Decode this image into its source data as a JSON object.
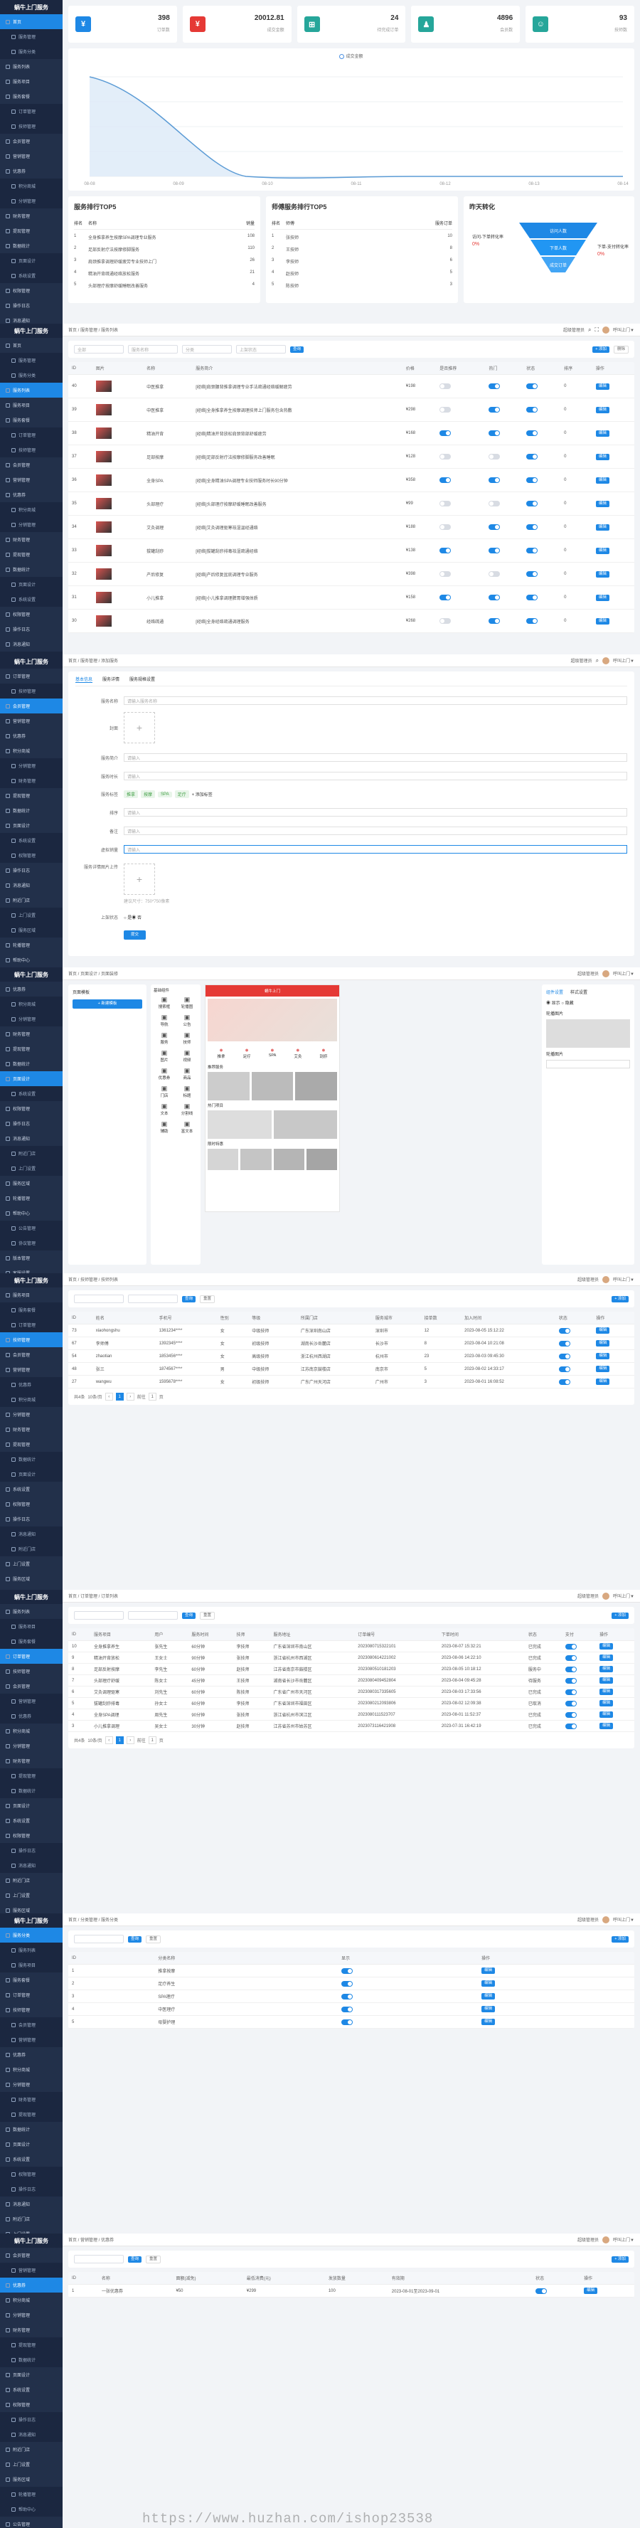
{
  "app": {
    "logo": "蜗牛上门服务",
    "user": "超级管理员",
    "user_short": "呼叫上门▼"
  },
  "common": {
    "add_btn": "+ 添加",
    "search_btn": "查询",
    "reset_btn": "重置",
    "edit_btn": "编辑",
    "del_btn": "删除",
    "total": "共4条",
    "per_page": "10条/页",
    "goto": "前往",
    "page_unit": "页"
  },
  "sidebar_main": [
    "首页",
    "服务管理",
    "服务分类",
    "服务列表",
    "服务项目",
    "服务套餐",
    "订单管理",
    "技师管理",
    "会员管理",
    "营销管理",
    "优惠券",
    "积分商城",
    "分销管理",
    "财务管理",
    "提现管理",
    "数据统计",
    "页面设计",
    "系统设置",
    "权限管理",
    "操作日志",
    "消息通知",
    "附近门店",
    "上门设置",
    "服务区域",
    "轮播管理",
    "帮助中心",
    "公告管理",
    "协议管理",
    "版本管理",
    "客服设置",
    "短信设置",
    "支付设置",
    "存储设置",
    "小程序",
    "公众号",
    "APP设置",
    "主题风格",
    "更多"
  ],
  "dashboard": {
    "stats": [
      {
        "icon": "¥",
        "value": "398",
        "label": "订单数",
        "color": "#1e88e5"
      },
      {
        "icon": "¥",
        "value": "20012.81",
        "label": "成交金额",
        "color": "#e53935"
      },
      {
        "icon": "⊞",
        "value": "24",
        "label": "待完成订单",
        "color": "#26a69a"
      },
      {
        "icon": "♟",
        "value": "4896",
        "label": "会员数",
        "color": "#26a69a"
      },
      {
        "icon": "☺",
        "value": "93",
        "label": "技师数",
        "color": "#26a69a"
      }
    ],
    "legend": "成交金额",
    "x_labels": [
      "08-08",
      "08-09",
      "08-10",
      "08-11",
      "08-12",
      "08-13",
      "08-14"
    ],
    "top_services": {
      "title": "服务排行TOP5",
      "h1": "排名",
      "h2": "名称",
      "h3": "销量",
      "rows": [
        [
          "1",
          "全身推拿养生按摩SPA调理专业服务",
          "108"
        ],
        [
          "2",
          "足部反射疗法按摩修脚服务",
          "110"
        ],
        [
          "3",
          "肩颈推拿调理舒缓疲劳专业技师上门",
          "26"
        ],
        [
          "4",
          "精油开背疏通经络放松服务",
          "21"
        ],
        [
          "5",
          "头部理疗按摩舒缓睡眠改善服务",
          "4"
        ]
      ]
    },
    "top_tech": {
      "title": "师傅服务排行TOP5",
      "h1": "排名",
      "h2": "师傅",
      "h3": "服务订单",
      "rows": [
        [
          "1",
          "张技师",
          "10"
        ],
        [
          "2",
          "王技师",
          "8"
        ],
        [
          "3",
          "李技师",
          "6"
        ],
        [
          "4",
          "赵技师",
          "5"
        ],
        [
          "5",
          "陈技师",
          "3"
        ]
      ]
    },
    "funnel": {
      "title": "昨天转化",
      "layers": [
        "访问人数",
        "下单人数",
        "成交订单"
      ],
      "labels": [
        "访问-下单转化率",
        "下单-支付转化率"
      ],
      "pcts": [
        "0%",
        "0%"
      ]
    }
  },
  "services": {
    "crumb": "首页 / 服务管理 / 服务列表",
    "filters": [
      "全部",
      "服务名称",
      "分类",
      "上架状态"
    ],
    "columns": [
      "ID",
      "图片",
      "名称",
      "服务简介",
      "价格",
      "是否推荐",
      "热门",
      "状态",
      "排序",
      "操作"
    ],
    "rows": [
      {
        "id": "40",
        "name": "中医推拿",
        "desc": "[经络]肩颈腰背推拿调理专业手法疏通经络缓解疲劳",
        "price": "¥198",
        "rec": false,
        "hot": true,
        "st": true,
        "sort": "0"
      },
      {
        "id": "39",
        "name": "中医推拿",
        "desc": "[经络]全身推拿养生按摩调理技师上门服务包含热敷",
        "price": "¥298",
        "rec": false,
        "hot": true,
        "st": true,
        "sort": "0"
      },
      {
        "id": "38",
        "name": "精油开背",
        "desc": "[经络]精油开背放松肩颈背部舒缓疲劳",
        "price": "¥168",
        "rec": true,
        "hot": true,
        "st": true,
        "sort": "0"
      },
      {
        "id": "37",
        "name": "足部按摩",
        "desc": "[经络]足部反射疗法按摩修脚服务改善睡眠",
        "price": "¥128",
        "rec": false,
        "hot": false,
        "st": true,
        "sort": "0"
      },
      {
        "id": "36",
        "name": "全身SPA",
        "desc": "[经络]全身精油SPA调理专业技师服务时长90分钟",
        "price": "¥358",
        "rec": true,
        "hot": true,
        "st": true,
        "sort": "0"
      },
      {
        "id": "35",
        "name": "头部理疗",
        "desc": "[经络]头部理疗按摩舒缓睡眠改善服务",
        "price": "¥99",
        "rec": false,
        "hot": false,
        "st": true,
        "sort": "0"
      },
      {
        "id": "34",
        "name": "艾灸调理",
        "desc": "[经络]艾灸调理驱寒祛湿温经通络",
        "price": "¥188",
        "rec": false,
        "hot": true,
        "st": true,
        "sort": "0"
      },
      {
        "id": "33",
        "name": "拔罐刮痧",
        "desc": "[经络]拔罐刮痧排毒祛湿疏通经络",
        "price": "¥138",
        "rec": true,
        "hot": true,
        "st": true,
        "sort": "0"
      },
      {
        "id": "32",
        "name": "产后修复",
        "desc": "[经络]产后修复盆底调理专业服务",
        "price": "¥398",
        "rec": false,
        "hot": false,
        "st": true,
        "sort": "0"
      },
      {
        "id": "31",
        "name": "小儿推拿",
        "desc": "[经络]小儿推拿调理脾胃增强体质",
        "price": "¥158",
        "rec": true,
        "hot": true,
        "st": true,
        "sort": "0"
      },
      {
        "id": "30",
        "name": "经络疏通",
        "desc": "[经络]全身经络疏通调理服务",
        "price": "¥268",
        "rec": false,
        "hot": true,
        "st": true,
        "sort": "0"
      }
    ]
  },
  "form": {
    "crumb": "首页 / 服务管理 / 添加服务",
    "tabs": [
      "基本信息",
      "服务详情",
      "服务规格设置"
    ],
    "fields": [
      {
        "label": "服务名称",
        "value": "请输入服务名称"
      },
      {
        "label": "封面",
        "value": ""
      },
      {
        "label": "服务简介",
        "value": "请输入"
      },
      {
        "label": "服务时长",
        "value": "请输入"
      },
      {
        "label": "服务标签",
        "value": ""
      },
      {
        "label": "排序",
        "value": "请输入"
      },
      {
        "label": "备注",
        "value": "请输入"
      },
      {
        "label": "虚拟销量",
        "value": "请输入"
      }
    ],
    "tags": [
      "推拿",
      "按摩",
      "SPA",
      "足疗"
    ],
    "tag_add": "+ 添加标签",
    "upload_hint": "建议尺寸：750*750像素",
    "multi_label": "服务详情图片上传",
    "status_label": "上架状态",
    "status_opts": [
      "是",
      "否"
    ],
    "submit": "提交"
  },
  "designer": {
    "crumb": "首页 / 页面设计 / 页面装修",
    "left_title": "页面模板",
    "left_btn": "+ 新建模板",
    "comp_title": "基础组件",
    "comps": [
      "搜索框",
      "轮播图",
      "导航",
      "公告",
      "服务",
      "技师",
      "图片",
      "视频",
      "优惠券",
      "商品",
      "门店",
      "标题",
      "文本",
      "分割线",
      "辅助",
      "富文本"
    ],
    "phone_title": "蜗牛上门",
    "phone_nav": [
      "推拿",
      "足疗",
      "SPA",
      "艾灸",
      "刮痧"
    ],
    "phone_sec1": "推荐服务",
    "phone_sec2": "热门项目",
    "phone_sec3": "限时特惠",
    "right_title": "组件设置",
    "right_tabs": [
      "组件设置",
      "样式设置"
    ],
    "right_radio": [
      "显示",
      "隐藏"
    ],
    "right_item": "轮播图片"
  },
  "techs": {
    "crumb": "首页 / 技师管理 / 技师列表",
    "columns": [
      "ID",
      "姓名",
      "手机号",
      "性别",
      "等级",
      "所属门店",
      "服务城市",
      "接单数",
      "加入时间",
      "状态",
      "操作"
    ],
    "rows": [
      [
        "73",
        "xiaohongshu",
        "1361234****",
        "女",
        "中级技师",
        "广东深圳南山店",
        "深圳市",
        "12",
        "2023-08-05 15:12:22"
      ],
      [
        "67",
        "李师傅",
        "1392345****",
        "女",
        "初级技师",
        "湖南长沙岳麓店",
        "长沙市",
        "8",
        "2023-08-04 10:21:08"
      ],
      [
        "54",
        "zhaotian",
        "1853456****",
        "女",
        "高级技师",
        "浙江杭州西湖店",
        "杭州市",
        "23",
        "2023-08-03 09:45:30"
      ],
      [
        "48",
        "张三",
        "1874567****",
        "男",
        "中级技师",
        "江苏南京鼓楼店",
        "南京市",
        "5",
        "2023-08-02 14:33:17"
      ],
      [
        "27",
        "wangwu",
        "1595678****",
        "女",
        "初级技师",
        "广东广州天河店",
        "广州市",
        "3",
        "2023-08-01 16:08:52"
      ]
    ]
  },
  "orders": {
    "crumb": "首页 / 订单管理 / 订单列表",
    "columns": [
      "ID",
      "服务项目",
      "用户",
      "服务时间",
      "技师",
      "服务地址",
      "订单编号",
      "下单时间",
      "状态",
      "支付",
      "操作"
    ],
    "rows": [
      [
        "10",
        "全身推拿养生",
        "张先生",
        "60分钟",
        "李技师",
        "广东省深圳市南山区",
        "2023080715322101",
        "2023-08-07 15:32:21",
        "已完成"
      ],
      [
        "9",
        "精油开背放松",
        "王女士",
        "90分钟",
        "张技师",
        "浙江省杭州市西湖区",
        "2023080614221002",
        "2023-08-06 14:22:10",
        "已完成"
      ],
      [
        "8",
        "足部反射按摩",
        "李先生",
        "60分钟",
        "赵技师",
        "江苏省南京市鼓楼区",
        "2023080510181203",
        "2023-08-05 10:18:12",
        "服务中"
      ],
      [
        "7",
        "头部理疗舒缓",
        "陈女士",
        "45分钟",
        "王技师",
        "湖南省长沙市岳麓区",
        "2023080409452804",
        "2023-08-04 09:45:28",
        "待服务"
      ],
      [
        "6",
        "艾灸调理驱寒",
        "刘先生",
        "60分钟",
        "陈技师",
        "广东省广州市天河区",
        "2023080317335605",
        "2023-08-03 17:33:56",
        "已完成"
      ],
      [
        "5",
        "拔罐刮痧排毒",
        "孙女士",
        "60分钟",
        "李技师",
        "广东省深圳市福田区",
        "2023080212093806",
        "2023-08-02 12:09:38",
        "已取消"
      ],
      [
        "4",
        "全身SPA调理",
        "周先生",
        "90分钟",
        "张技师",
        "浙江省杭州市滨江区",
        "2023080111523707",
        "2023-08-01 11:52:37",
        "已完成"
      ],
      [
        "3",
        "小儿推拿调理",
        "吴女士",
        "30分钟",
        "赵技师",
        "江苏省苏州市姑苏区",
        "2023073116421908",
        "2023-07-31 16:42:19",
        "已完成"
      ]
    ]
  },
  "category": {
    "crumb": "首页 / 分类管理 / 服务分类",
    "columns": [
      "ID",
      "分类名称",
      "显示",
      "操作"
    ],
    "rows": [
      [
        "1",
        "推拿按摩"
      ],
      [
        "2",
        "足疗养生"
      ],
      [
        "3",
        "SPA理疗"
      ],
      [
        "4",
        "中医理疗"
      ],
      [
        "5",
        "母婴护理"
      ]
    ]
  },
  "coupon": {
    "crumb": "首页 / 营销管理 / 优惠券",
    "columns": [
      "ID",
      "名称",
      "面额(减免)",
      "最低消费(元)",
      "发放数量",
      "有效期",
      "状态",
      "操作"
    ],
    "row": [
      "1",
      "一张优惠券",
      "¥50",
      "¥299",
      "100",
      "2023-08-01至2023-09-01"
    ]
  },
  "watermark": "https://www.huzhan.com/ishop23538"
}
